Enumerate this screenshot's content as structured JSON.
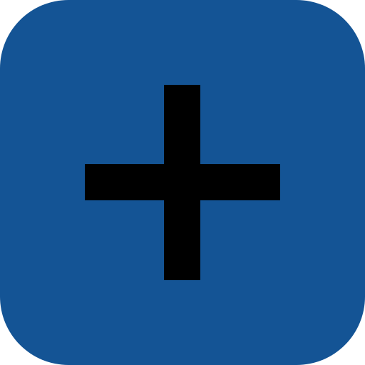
{
  "add_button": {
    "icon": "plus-icon",
    "background_color": "#145495",
    "icon_color": "#000000"
  }
}
